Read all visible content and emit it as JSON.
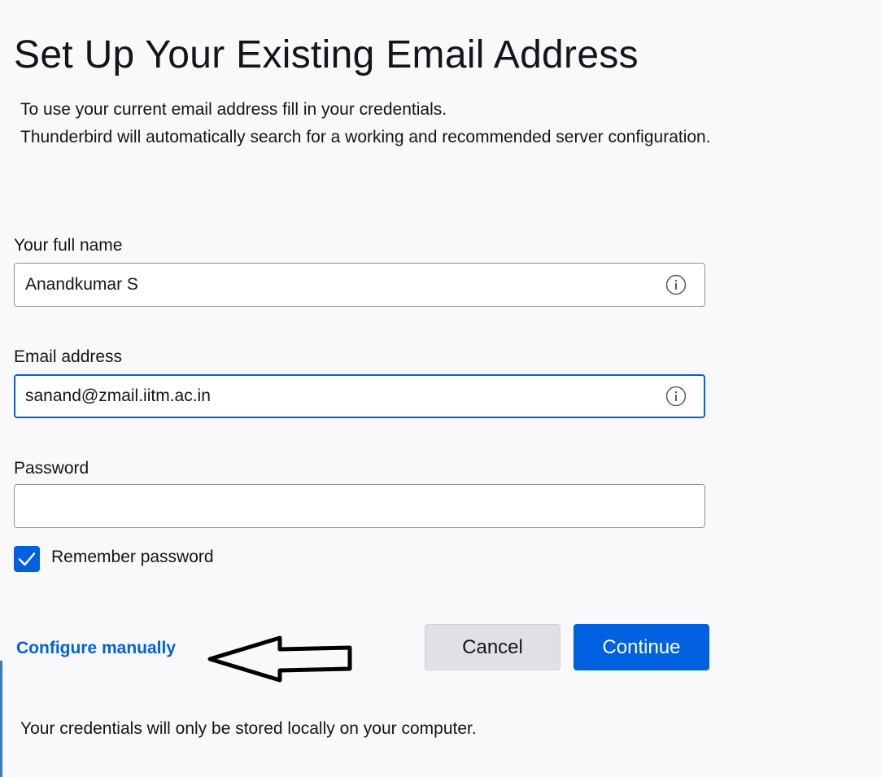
{
  "header": {
    "title": "Set Up Your Existing Email Address",
    "intro_line1": "To use your current email address fill in your credentials.",
    "intro_line2": "Thunderbird will automatically search for a working and recommended server configuration."
  },
  "form": {
    "full_name": {
      "label": "Your full name",
      "value": "Anandkumar S",
      "info_icon": "info-icon"
    },
    "email": {
      "label": "Email address",
      "value": "sanand@zmail.iitm.ac.in",
      "info_icon": "info-icon",
      "focused": true
    },
    "password": {
      "label": "Password",
      "value": ""
    },
    "remember_password": {
      "label": "Remember password",
      "checked": true
    }
  },
  "actions": {
    "configure_manually": "Configure manually",
    "cancel": "Cancel",
    "continue": "Continue"
  },
  "annotation": {
    "arrow_icon": "left-arrow-icon"
  },
  "footer": {
    "note": "Your credentials will only be stored locally on your computer."
  },
  "colors": {
    "background": "#f9f9fb",
    "accent": "#0061e0",
    "text": "#15141a",
    "cancel_button": "#e0e0e6"
  }
}
